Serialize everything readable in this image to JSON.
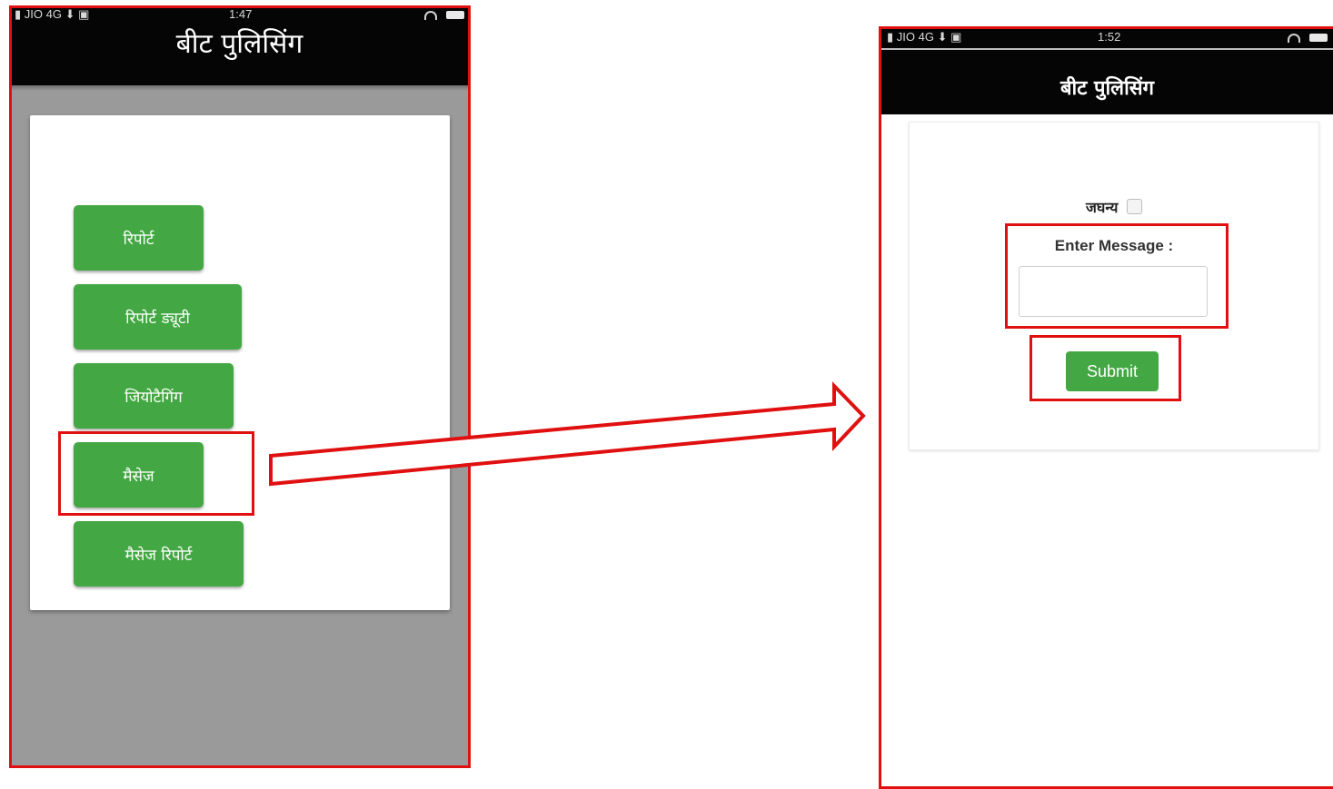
{
  "left_screen": {
    "status_bar": {
      "carrier": "JIO 4G",
      "time": "1:47"
    },
    "title": "बीट पुलिसिंग",
    "menu": [
      {
        "label": "रिपोर्ट"
      },
      {
        "label": "रिपोर्ट ड्यूटी"
      },
      {
        "label": "जियोटैगिंग"
      },
      {
        "label": "मैसेज"
      },
      {
        "label": "मैसेज रिपोर्ट"
      }
    ]
  },
  "right_screen": {
    "status_bar": {
      "carrier": "JIO 4G",
      "time": "1:52"
    },
    "title": "बीट पुलिसिंग",
    "form": {
      "checkbox_label": "जघन्य",
      "checkbox_checked": false,
      "message_label": "Enter Message :",
      "message_value": "",
      "submit_label": "Submit"
    }
  },
  "colors": {
    "header": "#050505",
    "button_green": "#43a843",
    "highlight_red": "#e01010",
    "left_background": "#9a9a9a"
  },
  "icons": [
    "signal-icon",
    "download-icon",
    "camera-icon",
    "wifi-icon",
    "battery-icon",
    "arrow-right-icon"
  ]
}
